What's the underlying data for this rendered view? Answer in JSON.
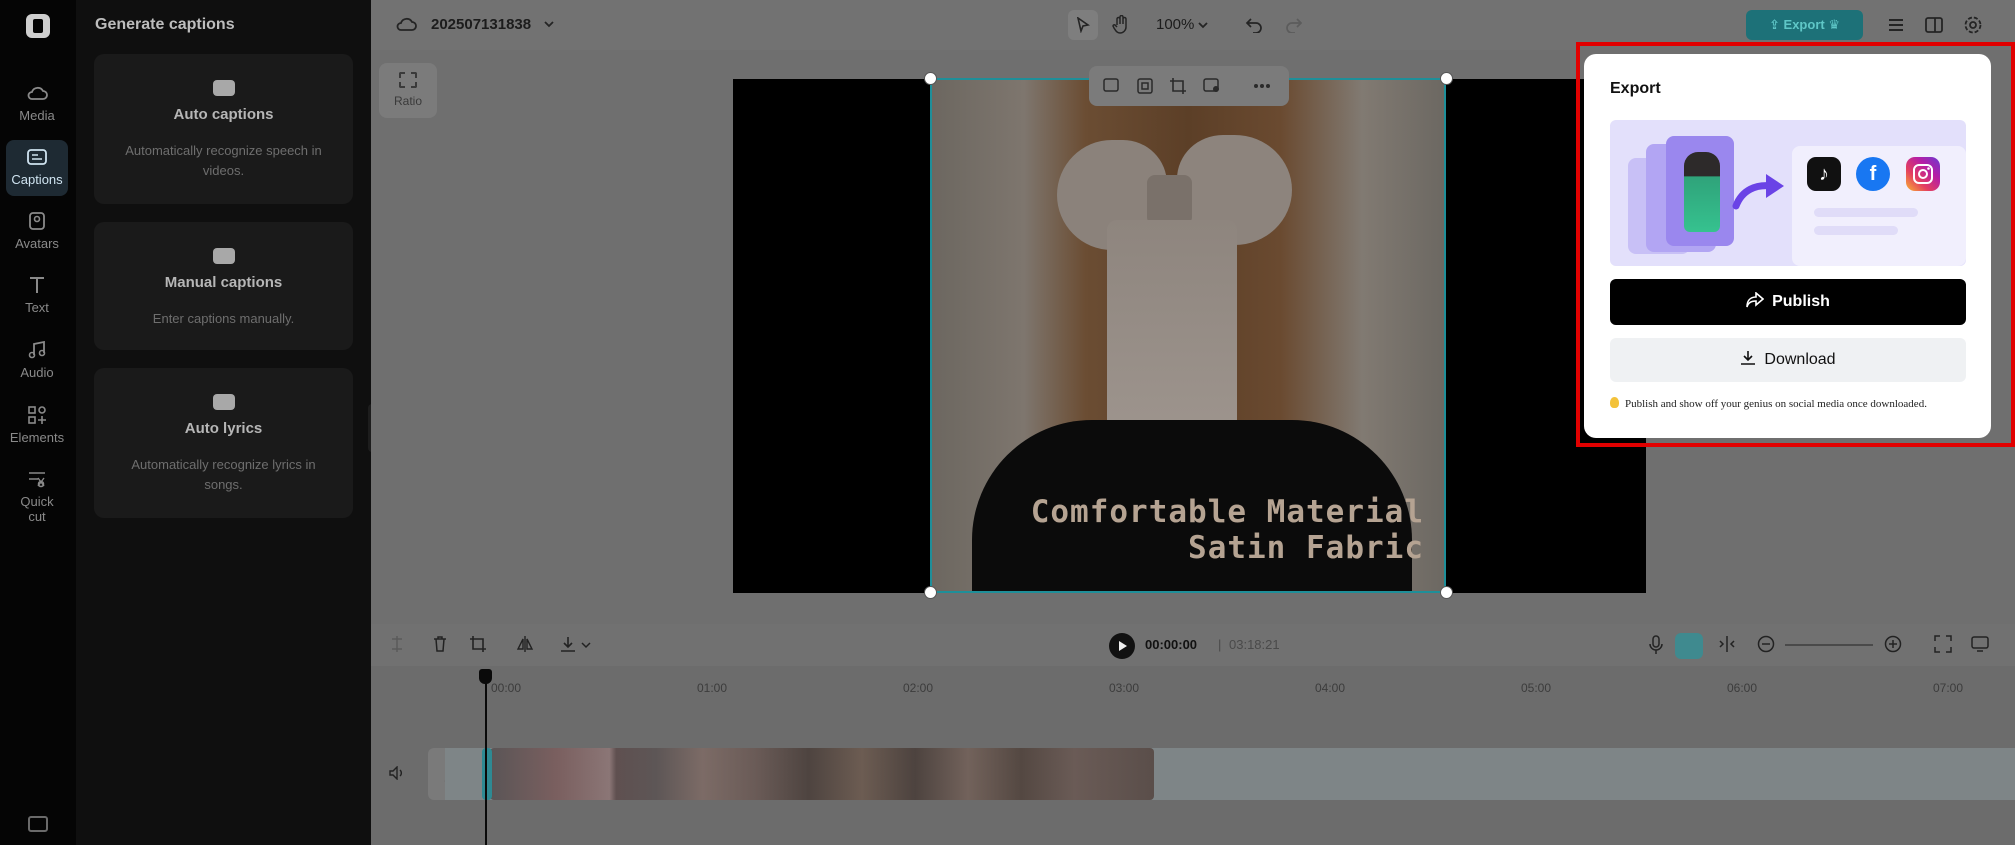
{
  "rail": {
    "items": [
      {
        "label": "Media",
        "icon": "cloud-icon"
      },
      {
        "label": "Captions",
        "icon": "captions-icon"
      },
      {
        "label": "Avatars",
        "icon": "avatar-icon"
      },
      {
        "label": "Text",
        "icon": "text-icon"
      },
      {
        "label": "Audio",
        "icon": "music-icon"
      },
      {
        "label": "Elements",
        "icon": "elements-icon"
      },
      {
        "label": "Quick",
        "label2": "cut",
        "icon": "scissors-icon"
      }
    ]
  },
  "panel": {
    "title": "Generate captions",
    "cards": [
      {
        "title": "Auto captions",
        "desc": "Automatically recognize speech in videos."
      },
      {
        "title": "Manual captions",
        "desc": "Enter captions manually."
      },
      {
        "title": "Auto lyrics",
        "desc": "Automatically recognize lyrics in songs."
      }
    ]
  },
  "topbar": {
    "project_name": "202507131838",
    "zoom": "100%",
    "export_label": "Export"
  },
  "canvas": {
    "ratio_label": "Ratio",
    "caption_line1": "Comfortable Material",
    "caption_line2": "Satin Fabric"
  },
  "timeline": {
    "current_time": "00:00:00",
    "total_time": "03:18:21",
    "ruler": [
      "00:00",
      "01:00",
      "02:00",
      "03:00",
      "04:00",
      "05:00",
      "06:00",
      "07:00"
    ]
  },
  "export_popup": {
    "title": "Export",
    "publish_label": "Publish",
    "download_label": "Download",
    "tip": "Publish and show off your genius on social media once downloaded.",
    "social": [
      "tiktok",
      "facebook",
      "instagram"
    ]
  },
  "colors": {
    "accent": "#1d7178",
    "highlight_frame": "#e10000",
    "publish_bg": "#000000"
  }
}
